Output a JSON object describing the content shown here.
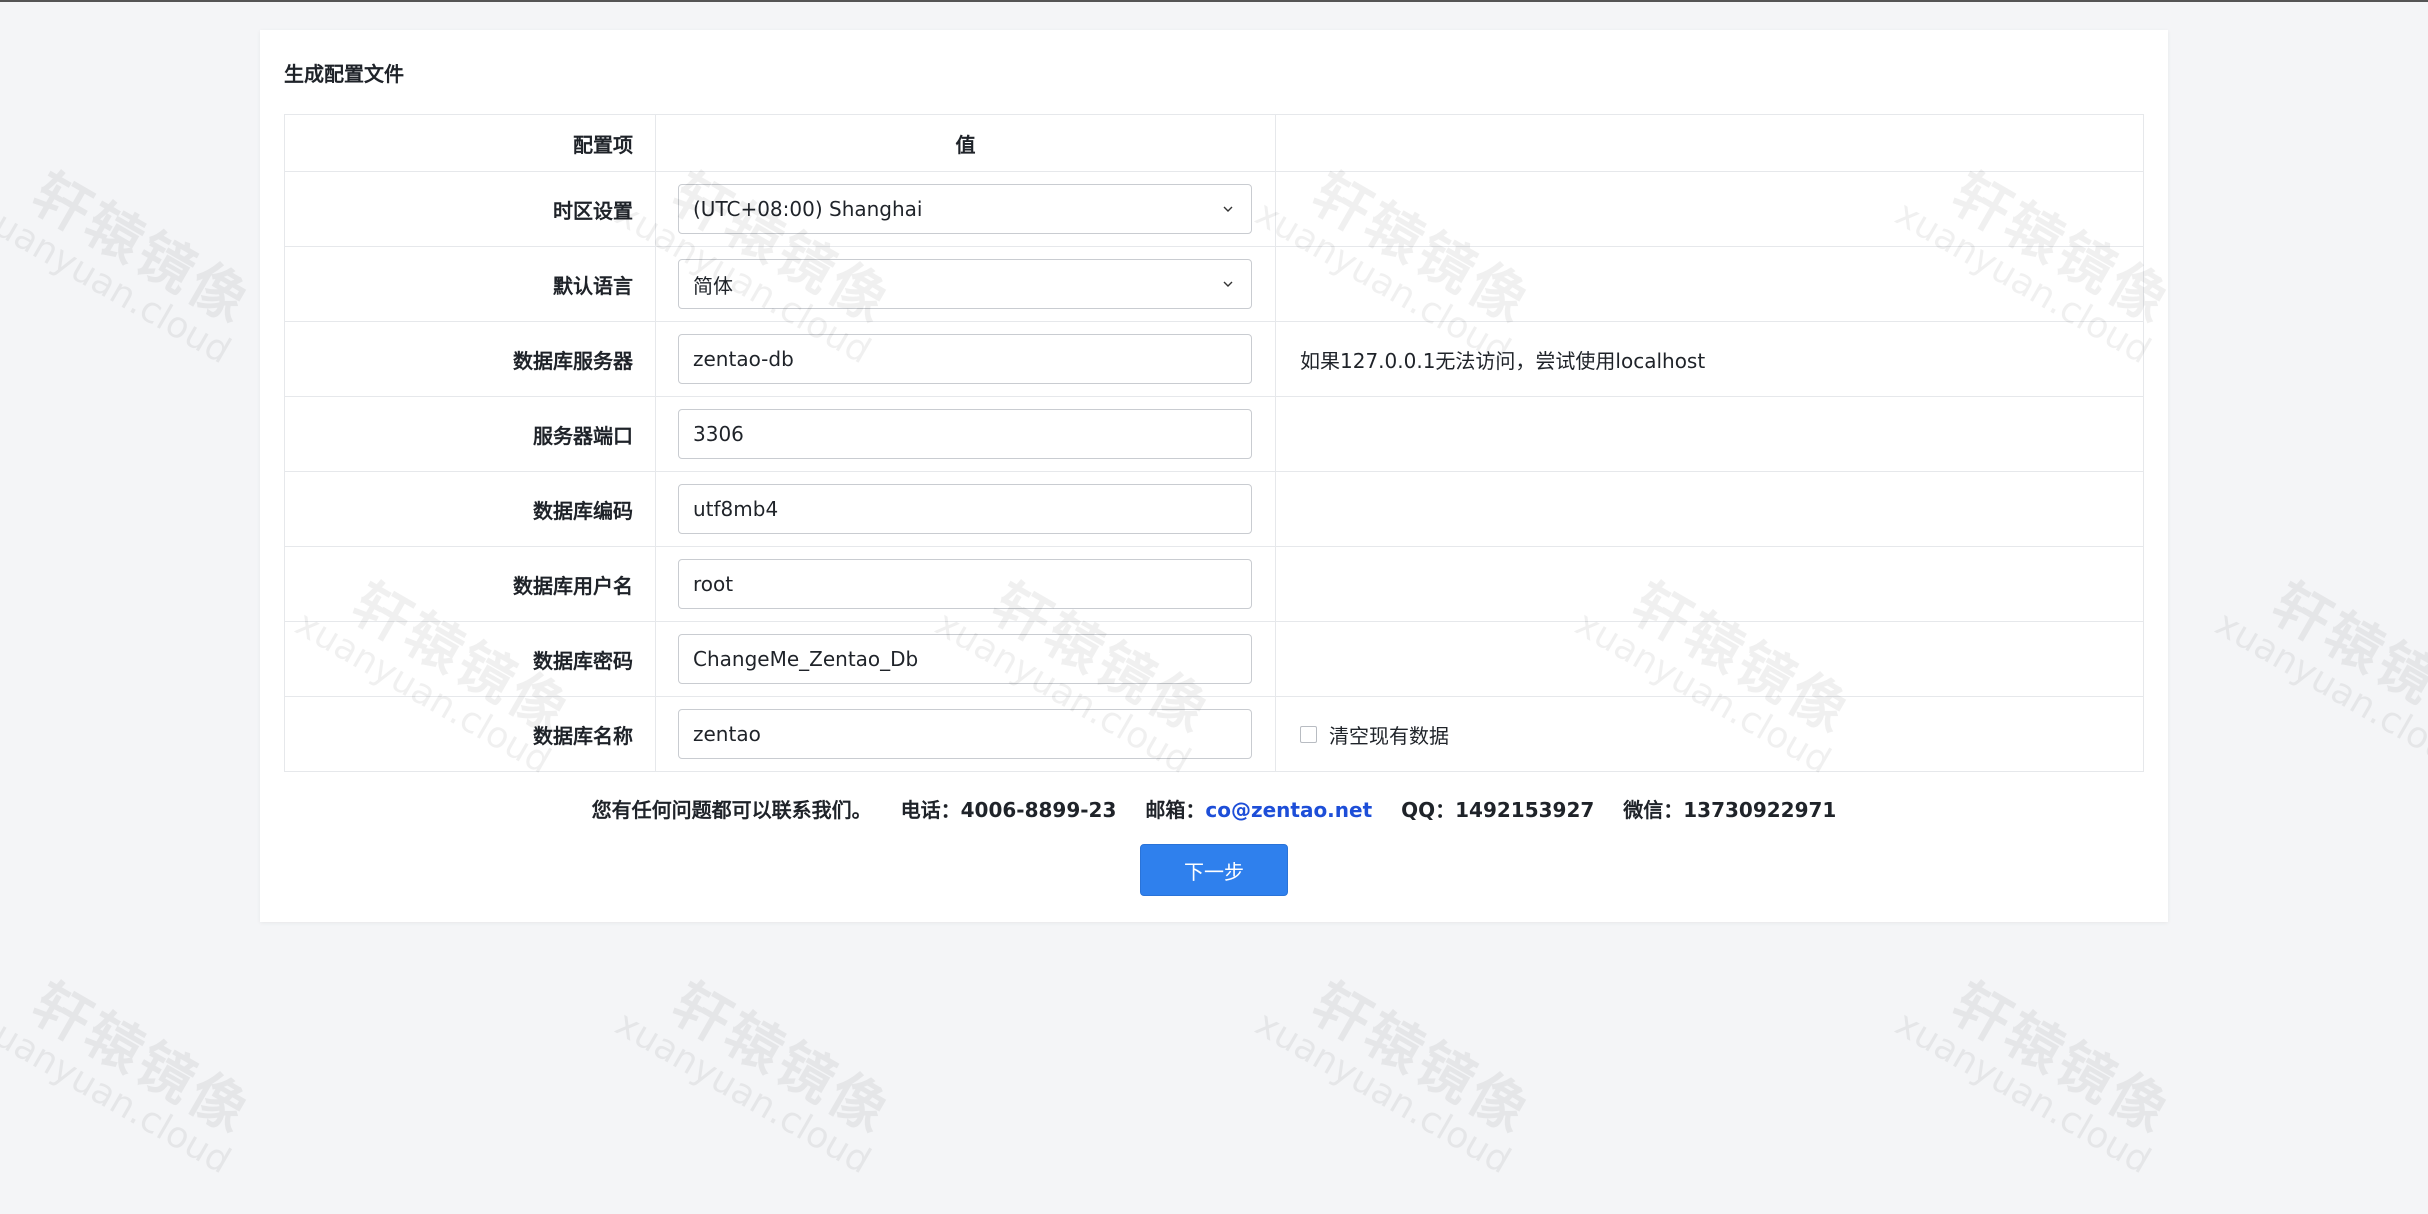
{
  "panel": {
    "title": "生成配置文件"
  },
  "table": {
    "headers": {
      "label": "配置项",
      "value": "值",
      "extra": ""
    },
    "rows": {
      "timezone": {
        "label": "时区设置",
        "value": "(UTC+08:00) Shanghai"
      },
      "language": {
        "label": "默认语言",
        "value": "简体"
      },
      "db_host": {
        "label": "数据库服务器",
        "value": "zentao-db",
        "hint": "如果127.0.0.1无法访问，尝试使用localhost"
      },
      "db_port": {
        "label": "服务器端口",
        "value": "3306"
      },
      "db_encoding": {
        "label": "数据库编码",
        "value": "utf8mb4"
      },
      "db_user": {
        "label": "数据库用户名",
        "value": "root"
      },
      "db_password": {
        "label": "数据库密码",
        "value": "ChangeMe_Zentao_Db"
      },
      "db_name": {
        "label": "数据库名称",
        "value": "zentao",
        "checkbox_label": "清空现有数据",
        "checkbox_checked": false
      }
    }
  },
  "contact": {
    "intro": "您有任何问题都可以联系我们。",
    "phone_label": "电话：",
    "phone": "4006-8899-23",
    "email_label": "邮箱：",
    "email": "co@zentao.net",
    "qq_label": "QQ：",
    "qq": "1492153927",
    "wechat_label": "微信：",
    "wechat": "13730922971"
  },
  "actions": {
    "next_label": "下一步"
  },
  "watermark": {
    "main": "轩辕镜像",
    "sub": "xuanyuan.cloud"
  },
  "colors": {
    "primary": "#2f80ed",
    "link": "#1d4ed8",
    "background": "#f4f5f7",
    "panel": "#ffffff",
    "border": "#e6e8eb"
  }
}
